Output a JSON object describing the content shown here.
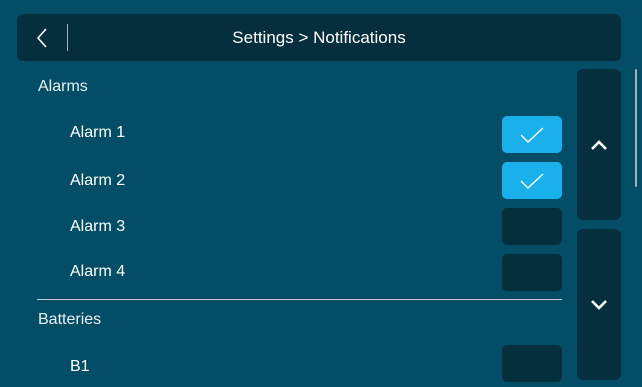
{
  "header": {
    "back_icon": "chevron-left-icon",
    "title": "Settings > Notifications"
  },
  "sections": [
    {
      "title": "Alarms",
      "items": [
        {
          "label": "Alarm 1",
          "checked": true
        },
        {
          "label": "Alarm 2",
          "checked": true
        },
        {
          "label": "Alarm 3",
          "checked": false
        },
        {
          "label": "Alarm 4",
          "checked": false
        }
      ]
    },
    {
      "title": "Batteries",
      "items": [
        {
          "label": "B1",
          "checked": false
        }
      ]
    }
  ],
  "scroll": {
    "up_icon": "chevron-up-icon",
    "down_icon": "chevron-down-icon"
  },
  "colors": {
    "background": "#034e66",
    "panel": "#062f3d",
    "accent": "#1ab0ec"
  }
}
